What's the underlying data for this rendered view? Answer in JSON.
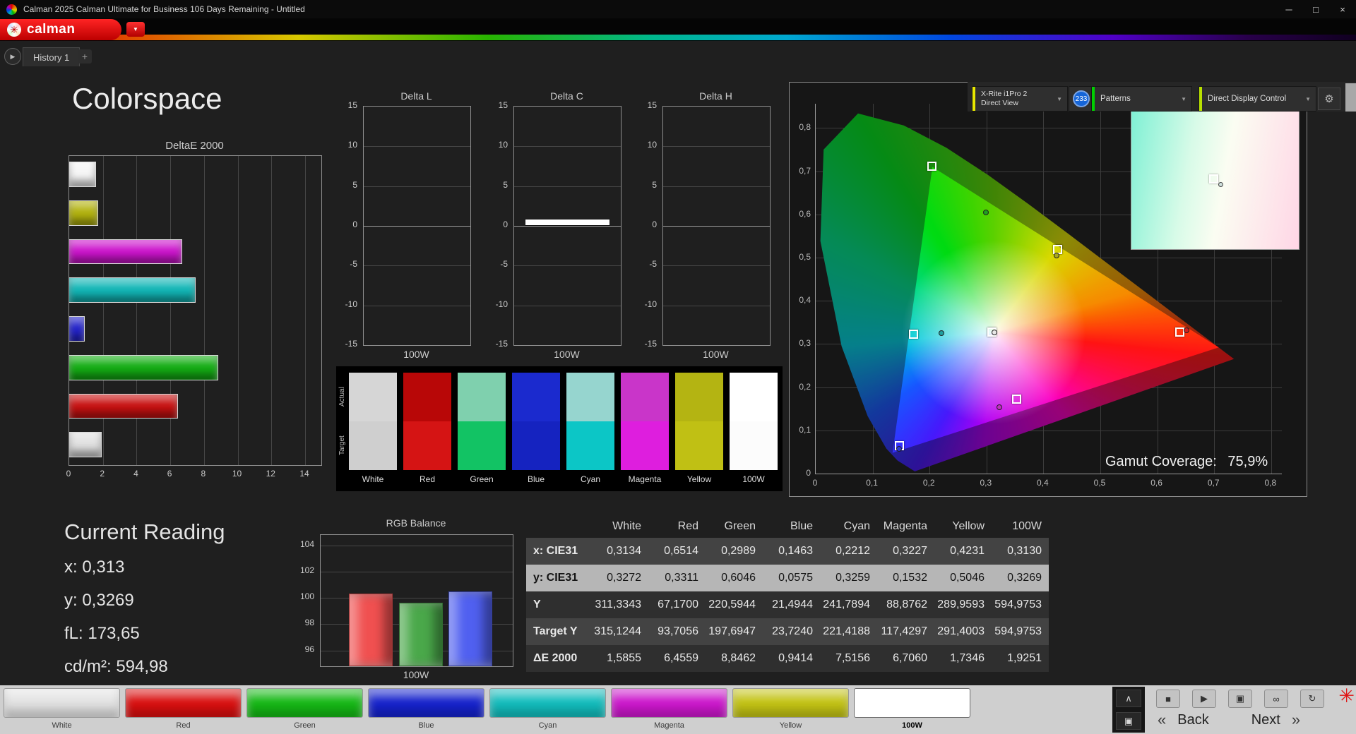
{
  "window": {
    "title": "Calman 2025 Calman Ultimate for Business 106 Days Remaining  - Untitled"
  },
  "icons": {
    "minimize": "─",
    "maximize": "□",
    "close": "×",
    "dropdown_arrow": "▼",
    "play": "▶",
    "add_tab": "+",
    "gear": "⚙",
    "stop": "■",
    "capture": "▣",
    "link": "∞",
    "refresh": "↻",
    "chevron_up": "∧",
    "back_chevrons": "«",
    "next_chevrons": "»",
    "brand_asterisk": "✳"
  },
  "brand": {
    "logo_text": "calman"
  },
  "tabs": {
    "history_tab": "History 1"
  },
  "toolbar": {
    "meter_line1": "X-Rite i1Pro 2",
    "meter_line2": "Direct View",
    "meter_badge": "233",
    "patterns_label": "Patterns",
    "display_control_label": "Direct Display Control"
  },
  "page": {
    "title": "Colorspace"
  },
  "current_reading": {
    "title": "Current Reading",
    "lines": [
      "x: 0,313",
      "y: 0,3269",
      "fL: 173,65",
      "cd/m²: 594,98"
    ]
  },
  "cie": {
    "gamut_coverage_label": "Gamut Coverage:",
    "gamut_coverage_value": "75,9%"
  },
  "swatch_strip": {
    "row_labels": [
      "Actual",
      "Target"
    ],
    "columns": [
      {
        "label": "White",
        "actual": "#d6d6d6",
        "target": "#cfcfcf"
      },
      {
        "label": "Red",
        "actual": "#b80707",
        "target": "#d51414"
      },
      {
        "label": "Green",
        "actual": "#7fd0ae",
        "target": "#12c364"
      },
      {
        "label": "Blue",
        "actual": "#1b2ace",
        "target": "#1523c0"
      },
      {
        "label": "Cyan",
        "actual": "#96d5cf",
        "target": "#0cc6c6"
      },
      {
        "label": "Magenta",
        "actual": "#c935c9",
        "target": "#de1ede"
      },
      {
        "label": "Yellow",
        "actual": "#b4b412",
        "target": "#c0c014"
      },
      {
        "label": "100W",
        "actual": "#ffffff",
        "target": "#fcfcfc"
      }
    ]
  },
  "bottom_patches": {
    "items": [
      {
        "label": "White",
        "color": "#e2e2e2",
        "selected": false
      },
      {
        "label": "Red",
        "color": "#d90f0f",
        "selected": false
      },
      {
        "label": "Green",
        "color": "#15b815",
        "selected": false
      },
      {
        "label": "Blue",
        "color": "#1522cc",
        "selected": false
      },
      {
        "label": "Cyan",
        "color": "#12bcbc",
        "selected": false
      },
      {
        "label": "Magenta",
        "color": "#cc17cc",
        "selected": false
      },
      {
        "label": "Yellow",
        "color": "#c3c314",
        "selected": false
      },
      {
        "label": "100W",
        "color": "#ffffff",
        "selected": true
      }
    ]
  },
  "nav": {
    "back_label": "Back",
    "next_label": "Next"
  },
  "chart_data": [
    {
      "id": "deltae2000",
      "type": "bar",
      "orientation": "horizontal",
      "title": "DeltaE 2000",
      "categories": [
        "White",
        "Yellow",
        "Magenta",
        "Cyan",
        "Blue",
        "Green",
        "Red",
        "100W"
      ],
      "values": [
        1.5855,
        1.7346,
        6.706,
        7.5156,
        0.9414,
        8.8462,
        6.4559,
        1.9251
      ],
      "bar_colors": [
        "#f5f5f5",
        "#b2b20e",
        "#cc14cc",
        "#12b6b6",
        "#2222cc",
        "#14ad14",
        "#c81111",
        "#e0e0e0"
      ],
      "xlim": [
        0,
        14
      ],
      "xticks": [
        0,
        2,
        4,
        6,
        8,
        10,
        12,
        14
      ],
      "grid": true
    },
    {
      "id": "delta_l",
      "type": "bar",
      "title": "Delta L",
      "categories": [
        "100W"
      ],
      "values": [
        0
      ],
      "ylim": [
        -15,
        15
      ],
      "yticks": [
        15,
        10,
        5,
        0,
        -5,
        -10,
        -15
      ],
      "xlabel": "100W",
      "bar_color": "#ffffff"
    },
    {
      "id": "delta_c",
      "type": "bar",
      "title": "Delta C",
      "categories": [
        "100W"
      ],
      "values": [
        0.9
      ],
      "ylim": [
        -15,
        15
      ],
      "yticks": [
        15,
        10,
        5,
        0,
        -5,
        -10,
        -15
      ],
      "xlabel": "100W",
      "bar_color": "#ffffff"
    },
    {
      "id": "delta_h",
      "type": "bar",
      "title": "Delta H",
      "categories": [
        "100W"
      ],
      "values": [
        0
      ],
      "ylim": [
        -15,
        15
      ],
      "yticks": [
        15,
        10,
        5,
        0,
        -5,
        -10,
        -15
      ],
      "xlabel": "100W",
      "bar_color": "#ffffff"
    },
    {
      "id": "rgb_balance",
      "type": "bar",
      "title": "RGB Balance",
      "categories": [
        "Red",
        "Green",
        "Blue"
      ],
      "values": [
        100.35,
        99.65,
        100.5
      ],
      "bar_colors": [
        "#f05050",
        "#4aa84a",
        "#5060f0"
      ],
      "ylim": [
        94.8,
        104.8
      ],
      "yticks": [
        104,
        102,
        100,
        98,
        96
      ],
      "xlabel": "100W"
    },
    {
      "id": "cie1931",
      "type": "scatter",
      "title": "CIE 1931 xy",
      "xlim": [
        0,
        0.8
      ],
      "ylim": [
        0,
        0.85
      ],
      "xtick_labels": [
        "0",
        "0,1",
        "0,2",
        "0,3",
        "0,4",
        "0,5",
        "0,6",
        "0,7",
        "0,8"
      ],
      "ytick_labels": [
        "0",
        "0,1",
        "0,2",
        "0,3",
        "0,4",
        "0,5",
        "0,6",
        "0,7",
        "0,8"
      ],
      "gamut_coverage_pct": "75,9%",
      "gamut_triangle": [
        [
          0.205,
          0.71
        ],
        [
          0.708,
          0.292
        ],
        [
          0.135,
          0.048
        ]
      ],
      "target_points": [
        {
          "name": "green",
          "x": 0.205,
          "y": 0.71
        },
        {
          "name": "yellow",
          "x": 0.425,
          "y": 0.518
        },
        {
          "name": "red",
          "x": 0.64,
          "y": 0.326
        },
        {
          "name": "magenta",
          "x": 0.353,
          "y": 0.172
        },
        {
          "name": "blue",
          "x": 0.148,
          "y": 0.063
        },
        {
          "name": "cyan",
          "x": 0.173,
          "y": 0.322
        },
        {
          "name": "white",
          "x": 0.31,
          "y": 0.327
        }
      ],
      "measured_points": [
        {
          "name": "white",
          "x": 0.3134,
          "y": 0.3272,
          "color": "#e8e8e8"
        },
        {
          "name": "red",
          "x": 0.6514,
          "y": 0.3311,
          "color": "#d02020"
        },
        {
          "name": "green",
          "x": 0.2989,
          "y": 0.6046,
          "color": "#20a020"
        },
        {
          "name": "blue",
          "x": 0.1463,
          "y": 0.0575,
          "color": "#2838d8"
        },
        {
          "name": "cyan",
          "x": 0.2212,
          "y": 0.3259,
          "color": "#20a0a0"
        },
        {
          "name": "magenta",
          "x": 0.3227,
          "y": 0.1532,
          "color": "#c030c0"
        },
        {
          "name": "yellow",
          "x": 0.4231,
          "y": 0.5046,
          "color": "#a8a820"
        }
      ]
    },
    {
      "id": "measurement_table",
      "type": "table",
      "columns": [
        "",
        "White",
        "Red",
        "Green",
        "Blue",
        "Cyan",
        "Magenta",
        "Yellow",
        "100W"
      ],
      "rows": [
        {
          "label": "x: CIE31",
          "shade": "ra",
          "highlight": false,
          "values": [
            "0,3134",
            "0,6514",
            "0,2989",
            "0,1463",
            "0,2212",
            "0,3227",
            "0,4231",
            "0,3130"
          ]
        },
        {
          "label": "y: CIE31",
          "shade": "hl",
          "highlight": true,
          "values": [
            "0,3272",
            "0,3311",
            "0,6046",
            "0,0575",
            "0,3259",
            "0,1532",
            "0,5046",
            "0,3269"
          ]
        },
        {
          "label": "Y",
          "shade": "rb",
          "highlight": false,
          "values": [
            "311,3343",
            "67,1700",
            "220,5944",
            "21,4944",
            "241,7894",
            "88,8762",
            "289,9593",
            "594,9753"
          ]
        },
        {
          "label": "Target Y",
          "shade": "ra",
          "highlight": false,
          "values": [
            "315,1244",
            "93,7056",
            "197,6947",
            "23,7240",
            "221,4188",
            "117,4297",
            "291,4003",
            "594,9753"
          ]
        },
        {
          "label": "ΔE 2000",
          "shade": "rb",
          "highlight": false,
          "values": [
            "1,5855",
            "6,4559",
            "8,8462",
            "0,9414",
            "7,5156",
            "6,7060",
            "1,7346",
            "1,9251"
          ]
        }
      ]
    }
  ]
}
